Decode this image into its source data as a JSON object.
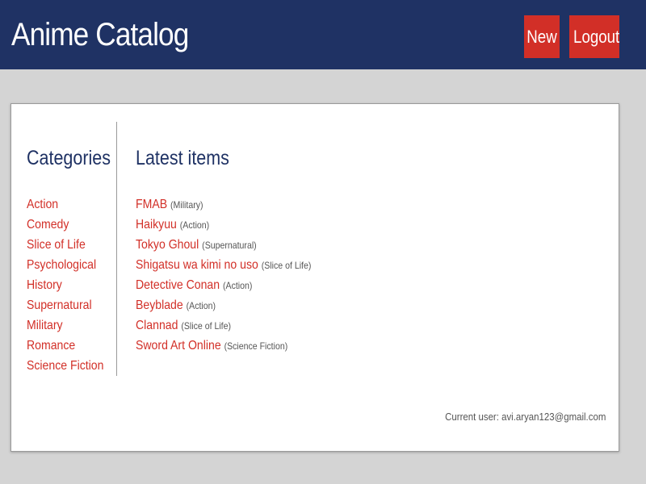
{
  "header": {
    "title": "Anime Catalog",
    "new_label": "New",
    "logout_label": "Logout"
  },
  "categories": {
    "title": "Categories",
    "items": [
      "Action",
      "Comedy",
      "Slice of Life",
      "Psychological",
      "History",
      "Supernatural",
      "Military",
      "Romance",
      "Science Fiction"
    ]
  },
  "latest": {
    "title": "Latest items",
    "items": [
      {
        "name": "FMAB",
        "category": "(Military)"
      },
      {
        "name": "Haikyuu",
        "category": "(Action)"
      },
      {
        "name": "Tokyo Ghoul",
        "category": "(Supernatural)"
      },
      {
        "name": "Shigatsu wa kimi no uso",
        "category": "(Slice of Life)"
      },
      {
        "name": "Detective Conan",
        "category": "(Action)"
      },
      {
        "name": "Beyblade",
        "category": "(Action)"
      },
      {
        "name": "Clannad",
        "category": "(Slice of Life)"
      },
      {
        "name": "Sword Art Online",
        "category": "(Science Fiction)"
      }
    ]
  },
  "footer": {
    "current_user": "Current user: avi.aryan123@gmail.com"
  },
  "colors": {
    "header_bg": "#1f3264",
    "accent": "#d22f27",
    "page_bg": "#d4d4d4"
  }
}
